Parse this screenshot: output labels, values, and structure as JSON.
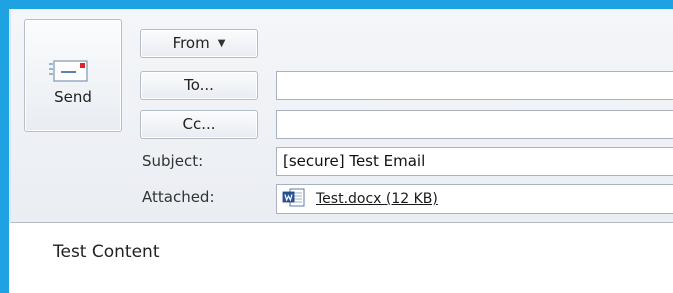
{
  "toolbar": {
    "send_label": "Send"
  },
  "header": {
    "from_label": "From",
    "to_label": "To...",
    "cc_label": "Cc...",
    "subject_label": "Subject:",
    "attached_label": "Attached:"
  },
  "fields": {
    "to_value": "",
    "cc_value": "",
    "subject_value": "[secure] Test Email",
    "attachment_name": "Test.docx (12 KB)"
  },
  "message": {
    "body": "Test Content"
  },
  "colors": {
    "window_border": "#1ea2e2",
    "header_background": "#eaedf2",
    "input_border": "#a9b3c0"
  },
  "icons": {
    "send": "envelope-send-icon",
    "from_dropdown": "chevron-down-icon",
    "attachment": "word-document-icon"
  }
}
